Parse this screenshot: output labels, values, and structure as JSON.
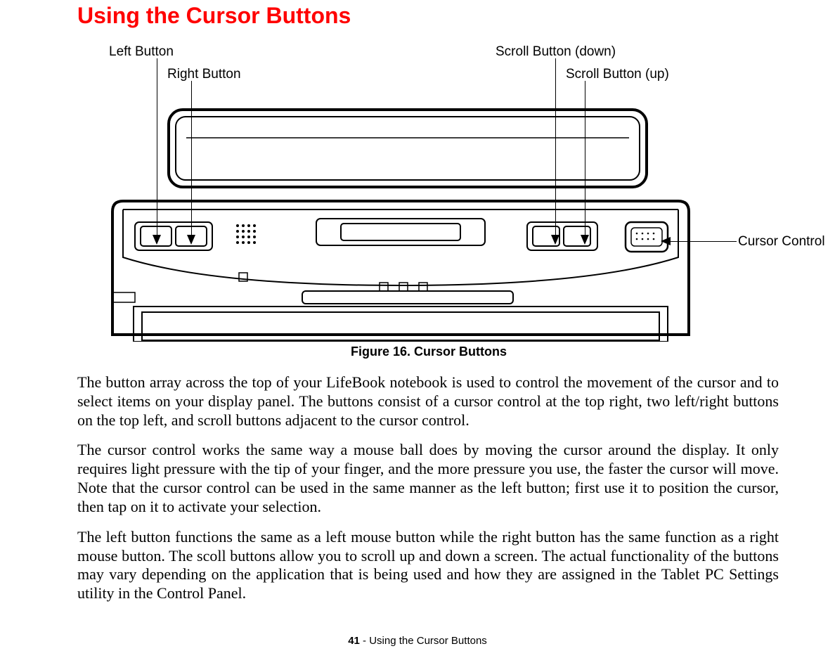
{
  "title": "Using the Cursor Buttons",
  "labels": {
    "left_button": "Left Button",
    "right_button": "Right Button",
    "scroll_down": "Scroll Button (down)",
    "scroll_up": "Scroll Button (up)",
    "cursor_control": "Cursor Control"
  },
  "figure_caption": "Figure 16.  Cursor Buttons",
  "paragraphs": {
    "p1": "The button array across the top of your LifeBook notebook is used to control the movement of the cursor and to select items on your display panel. The buttons consist of a cursor control at the top right, two left/right buttons on the top left, and scroll buttons adjacent to the cursor control.",
    "p2": "The cursor control works the same way a mouse ball does by moving the cursor around the display. It only requires light pressure with the tip of your finger, and the more pressure you use, the faster the cursor will move. Note that the cursor control can be used in the same manner as the left button; first use it to position the cursor, then tap on it to activate your selection.",
    "p3": "The left button functions the same as a left mouse button while the right button has the same function as a right mouse button. The scoll buttons allow you to scroll up and down a screen. The actual functionality of the buttons may vary depending on the application that is being used and how they are assigned in the Tablet PC Settings utility in the Control Panel."
  },
  "footer": {
    "page_number": "41",
    "separator": " - ",
    "section": "Using the Cursor Buttons"
  }
}
